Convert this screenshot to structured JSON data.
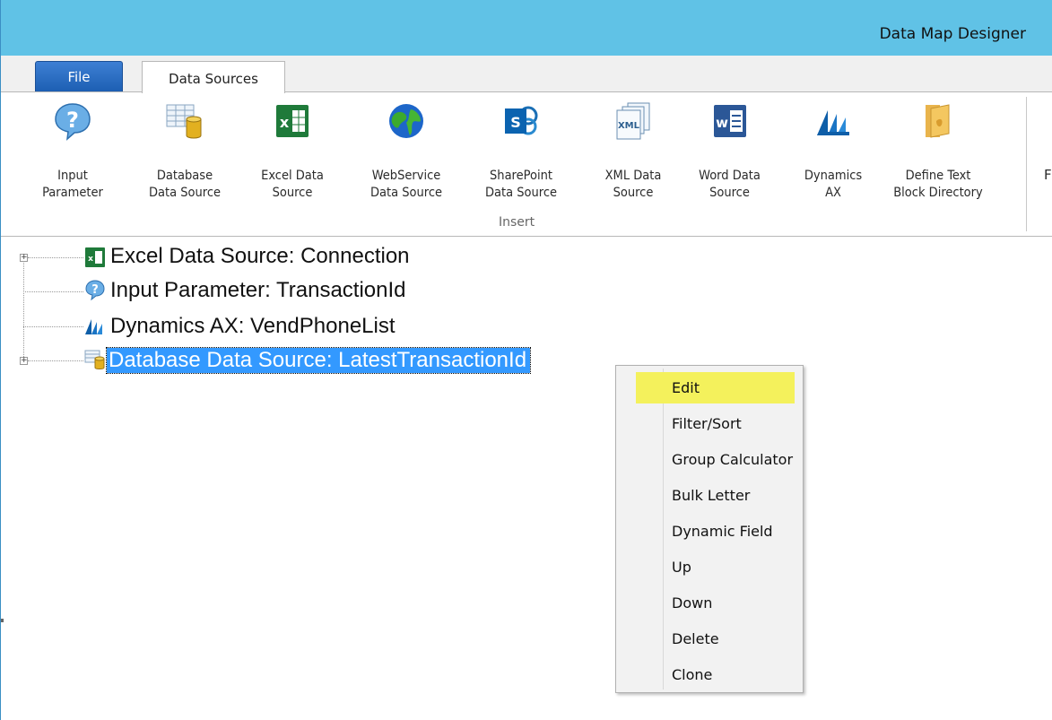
{
  "window": {
    "title": "Data Map Designer"
  },
  "tabs": {
    "file": "File",
    "data_sources": "Data Sources"
  },
  "ribbon": {
    "buttons": [
      {
        "line1": "Input",
        "line2": "Parameter",
        "icon": "input-parameter-icon"
      },
      {
        "line1": "Database",
        "line2": "Data Source",
        "icon": "database-icon"
      },
      {
        "line1": "Excel Data",
        "line2": "Source",
        "icon": "excel-icon"
      },
      {
        "line1": "WebService",
        "line2": "Data Source",
        "icon": "globe-icon"
      },
      {
        "line1": "SharePoint",
        "line2": "Data Source",
        "icon": "sharepoint-icon"
      },
      {
        "line1": "XML Data",
        "line2": "Source",
        "icon": "xml-icon"
      },
      {
        "line1": "Word Data",
        "line2": "Source",
        "icon": "word-icon"
      },
      {
        "line1": "Dynamics",
        "line2": "AX",
        "icon": "dynamics-ax-icon"
      },
      {
        "line1": "Define Text",
        "line2": "Block Directory",
        "icon": "folder-icon"
      }
    ],
    "group_label": "Insert",
    "overflow_text": "F"
  },
  "tree": {
    "nodes": [
      {
        "label": "Excel Data Source: Connection",
        "icon": "excel-icon",
        "expandable": true
      },
      {
        "label": "Input Parameter: TransactionId",
        "icon": "input-parameter-icon",
        "expandable": false
      },
      {
        "label": "Dynamics AX: VendPhoneList",
        "icon": "dynamics-ax-icon",
        "expandable": false
      },
      {
        "label": "Database Data Source: LatestTransactionId",
        "icon": "database-icon",
        "expandable": true,
        "selected": true
      }
    ]
  },
  "context_menu": {
    "items": [
      "Edit",
      "Filter/Sort",
      "Group Calculator",
      "Bulk Letter",
      "Dynamic Field",
      "Up",
      "Down",
      "Delete",
      "Clone"
    ],
    "highlighted": "Edit",
    "highlight_color": "#f4f15c"
  },
  "colors": {
    "titlebar": "#60c2e6",
    "file_tab": "#1d5fb3",
    "selection": "#3399ff"
  }
}
